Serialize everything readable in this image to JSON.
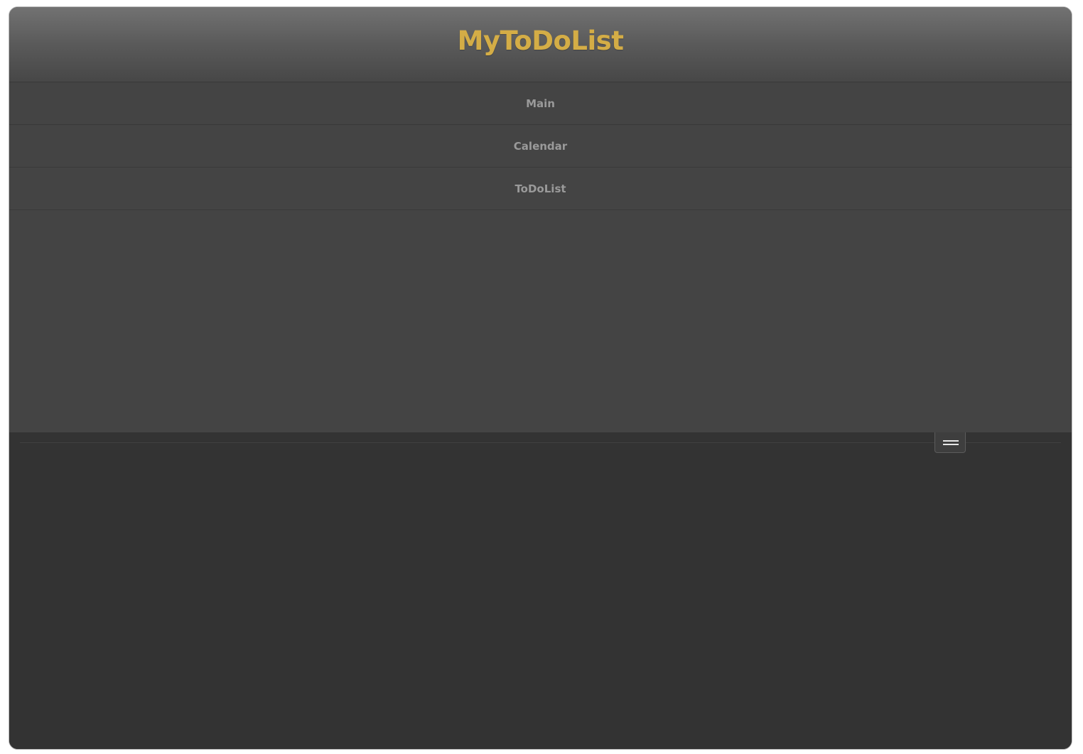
{
  "app": {
    "title": "MyToDoList",
    "title_color": "#d4ad46"
  },
  "nav": {
    "items": [
      {
        "label": "Main"
      },
      {
        "label": "Calendar"
      },
      {
        "label": "ToDoList"
      }
    ]
  },
  "toolbar": {
    "menu_toggle_icon": "hamburger-icon"
  },
  "colors": {
    "header_top": "#727272",
    "header_bottom": "#474747",
    "nav_background": "#444444",
    "content_background": "#333333",
    "nav_text": "#9a9a9a"
  }
}
